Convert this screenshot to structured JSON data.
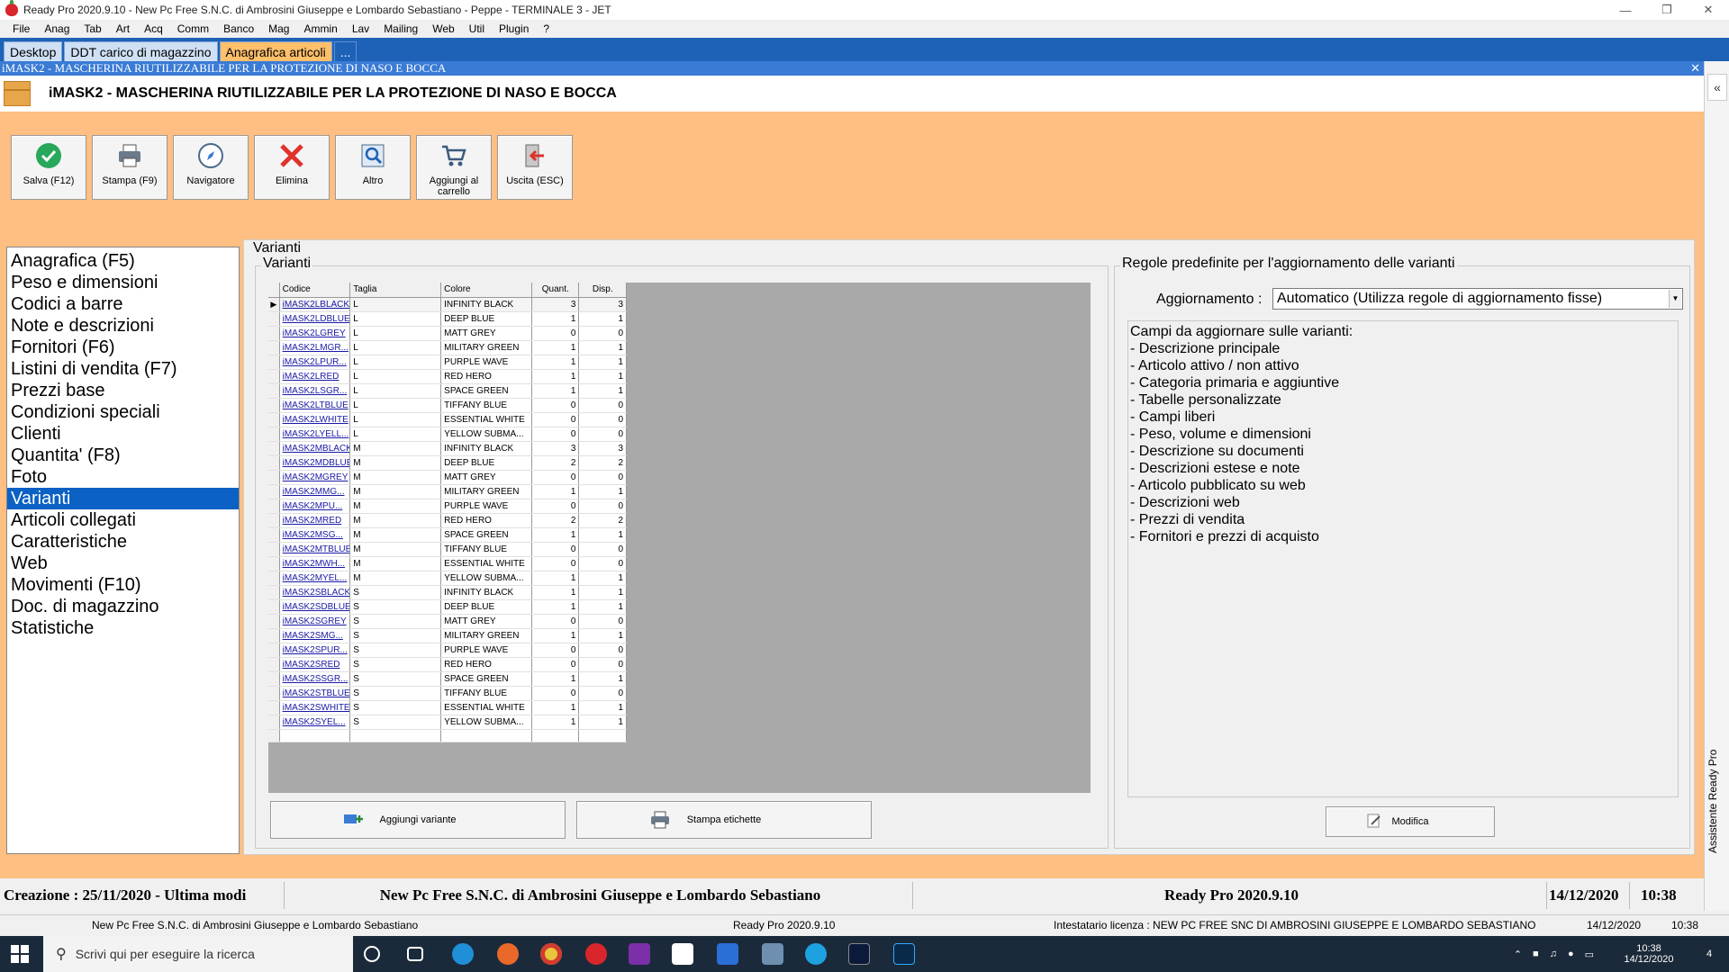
{
  "window": {
    "title": "Ready Pro 2020.9.10 - New Pc Free S.N.C. di Ambrosini Giuseppe e Lombardo Sebastiano - Peppe - TERMINALE 3 - JET"
  },
  "menu": [
    "File",
    "Anag",
    "Tab",
    "Art",
    "Acq",
    "Comm",
    "Banco",
    "Mag",
    "Ammin",
    "Lav",
    "Mailing",
    "Web",
    "Util",
    "Plugin",
    "?"
  ],
  "tabs": [
    {
      "label": "Desktop",
      "active": false
    },
    {
      "label": "DDT carico di magazzino",
      "active": false
    },
    {
      "label": "Anagrafica articoli",
      "active": true
    },
    {
      "label": "...",
      "active": false
    }
  ],
  "subwindow_title": "iMASK2 - MASCHERINA RIUTILIZZABILE PER LA PROTEZIONE DI NASO E BOCCA",
  "item_title": "iMASK2 - MASCHERINA RIUTILIZZABILE PER LA PROTEZIONE DI NASO E BOCCA",
  "right_sidebar_label": "Assistente Ready Pro",
  "toolbar": [
    {
      "label": "Salva (F12)",
      "icon": "check-icon"
    },
    {
      "label": "Stampa (F9)",
      "icon": "printer-icon"
    },
    {
      "label": "Navigatore",
      "icon": "compass-icon"
    },
    {
      "label": "Elimina",
      "icon": "delete-x-icon"
    },
    {
      "label": "Altro",
      "icon": "magnifier-icon"
    },
    {
      "label": "Aggiungi al carrello",
      "icon": "cart-icon"
    },
    {
      "label": "Uscita (ESC)",
      "icon": "exit-icon"
    }
  ],
  "nav": [
    "Anagrafica (F5)",
    "Peso e dimensioni",
    "Codici a barre",
    "Note e descrizioni",
    "Fornitori (F6)",
    "Listini di vendita (F7)",
    "Prezzi base",
    "Condizioni speciali",
    "Clienti",
    "Quantita' (F8)",
    "Foto",
    "Varianti",
    "Articoli collegati",
    "Caratteristiche",
    "Web",
    "Movimenti (F10)",
    "Doc. di magazzino",
    "Statistiche"
  ],
  "nav_selected": "Varianti",
  "panel_title": "Varianti",
  "variants_group_title": "Varianti",
  "grid": {
    "headers": [
      "Codice",
      "Taglia",
      "Colore",
      "Quant.",
      "Disp."
    ],
    "rows": [
      [
        "iMASK2LBLACK",
        "L",
        "INFINITY BLACK",
        "3",
        "3"
      ],
      [
        "iMASK2LDBLUE",
        "L",
        "DEEP BLUE",
        "1",
        "1"
      ],
      [
        "iMASK2LGREY",
        "L",
        "MATT GREY",
        "0",
        "0"
      ],
      [
        "iMASK2LMGR...",
        "L",
        "MILITARY GREEN",
        "1",
        "1"
      ],
      [
        "iMASK2LPUR...",
        "L",
        "PURPLE WAVE",
        "1",
        "1"
      ],
      [
        "iMASK2LRED",
        "L",
        "RED HERO",
        "1",
        "1"
      ],
      [
        "iMASK2LSGR...",
        "L",
        "SPACE GREEN",
        "1",
        "1"
      ],
      [
        "iMASK2LTBLUE",
        "L",
        "TIFFANY BLUE",
        "0",
        "0"
      ],
      [
        "iMASK2LWHITE",
        "L",
        "ESSENTIAL WHITE",
        "0",
        "0"
      ],
      [
        "iMASK2LYELL...",
        "L",
        "YELLOW SUBMA...",
        "0",
        "0"
      ],
      [
        "iMASK2MBLACK",
        "M",
        "INFINITY BLACK",
        "3",
        "3"
      ],
      [
        "iMASK2MDBLUE",
        "M",
        "DEEP BLUE",
        "2",
        "2"
      ],
      [
        "iMASK2MGREY",
        "M",
        "MATT GREY",
        "0",
        "0"
      ],
      [
        "iMASK2MMG...",
        "M",
        "MILITARY GREEN",
        "1",
        "1"
      ],
      [
        "iMASK2MPU...",
        "M",
        "PURPLE WAVE",
        "0",
        "0"
      ],
      [
        "iMASK2MRED",
        "M",
        "RED HERO",
        "2",
        "2"
      ],
      [
        "iMASK2MSG...",
        "M",
        "SPACE GREEN",
        "1",
        "1"
      ],
      [
        "iMASK2MTBLUE",
        "M",
        "TIFFANY BLUE",
        "0",
        "0"
      ],
      [
        "iMASK2MWH...",
        "M",
        "ESSENTIAL WHITE",
        "0",
        "0"
      ],
      [
        "iMASK2MYEL...",
        "M",
        "YELLOW SUBMA...",
        "1",
        "1"
      ],
      [
        "iMASK2SBLACK",
        "S",
        "INFINITY BLACK",
        "1",
        "1"
      ],
      [
        "iMASK2SDBLUE",
        "S",
        "DEEP BLUE",
        "1",
        "1"
      ],
      [
        "iMASK2SGREY",
        "S",
        "MATT GREY",
        "0",
        "0"
      ],
      [
        "iMASK2SMG...",
        "S",
        "MILITARY GREEN",
        "1",
        "1"
      ],
      [
        "iMASK2SPUR...",
        "S",
        "PURPLE WAVE",
        "0",
        "0"
      ],
      [
        "iMASK2SRED",
        "S",
        "RED HERO",
        "0",
        "0"
      ],
      [
        "iMASK2SSGR...",
        "S",
        "SPACE GREEN",
        "1",
        "1"
      ],
      [
        "iMASK2STBLUE",
        "S",
        "TIFFANY BLUE",
        "0",
        "0"
      ],
      [
        "iMASK2SWHITE",
        "S",
        "ESSENTIAL WHITE",
        "1",
        "1"
      ],
      [
        "iMASK2SYEL...",
        "S",
        "YELLOW SUBMA...",
        "1",
        "1"
      ]
    ]
  },
  "buttons": {
    "add_variant": "Aggiungi variante",
    "print_labels": "Stampa etichette",
    "modify": "Modifica"
  },
  "rules": {
    "group_title": "Regole predefinite per l'aggiornamento delle varianti",
    "update_label": "Aggiornamento :",
    "update_value": "Automatico (Utilizza regole di aggiornamento fisse)",
    "fields": [
      "Campi da aggiornare sulle varianti:",
      "- Descrizione principale",
      "- Articolo attivo / non attivo",
      "- Categoria primaria e aggiuntive",
      "- Tabelle personalizzate",
      "- Campi liberi",
      "- Peso, volume e dimensioni",
      "- Descrizione su documenti",
      "- Descrizioni estese e note",
      "- Articolo pubblicato su web",
      "- Descrizioni web",
      "- Prezzi di vendita",
      "- Fornitori e prezzi di acquisto"
    ]
  },
  "status_top": {
    "created": "Creazione : 25/11/2020 - Ultima modi",
    "company": "New Pc Free S.N.C. di Ambrosini Giuseppe e Lombardo Sebastiano",
    "version": "Ready Pro 2020.9.10",
    "date": "14/12/2020",
    "time": "10:38"
  },
  "status_bottom": {
    "company": "New Pc Free S.N.C. di Ambrosini Giuseppe e Lombardo Sebastiano",
    "version": "Ready Pro 2020.9.10",
    "license": "Intestatario licenza : NEW PC FREE SNC DI AMBROSINI GIUSEPPE E LOMBARDO SEBASTIANO",
    "date": "14/12/2020",
    "time": "10:38"
  },
  "taskbar": {
    "search_placeholder": "Scrivi qui per eseguire la ricerca",
    "clock_time": "10:38",
    "clock_date": "14/12/2020",
    "notification_count": "4"
  },
  "colors": {
    "orange_background": "#ffbe82",
    "tab_bar": "#1e62b7",
    "selection_blue": "#0b61c4",
    "active_tab": "#ffbf6b"
  }
}
